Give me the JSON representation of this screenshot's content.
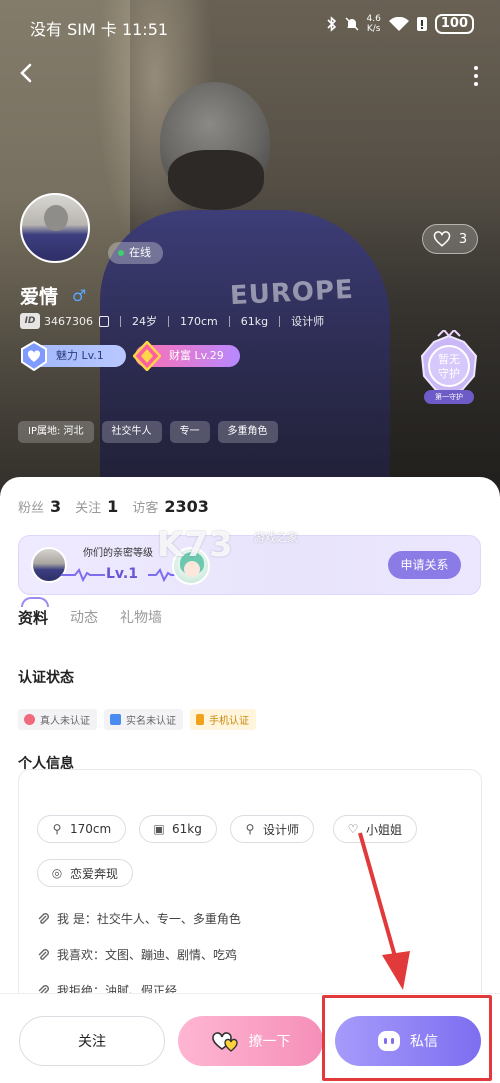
{
  "status_bar": {
    "carrier_time": "没有 SIM 卡 11:51",
    "net_speed_value": "4.6",
    "net_speed_unit": "K/s",
    "battery": "100"
  },
  "profile": {
    "online": "在线",
    "likes": "3",
    "username": "爱情",
    "id_label": "ID",
    "id": "3467306",
    "age": "24岁",
    "height": "170cm",
    "weight": "61kg",
    "job": "设计师",
    "charm_level": "魅力 Lv.1",
    "wealth_level": "财富 Lv.29",
    "guard_line1": "暂无",
    "guard_line2": "守护",
    "guard_rank": "第一守护",
    "tags": [
      "IP属地: 河北",
      "社交牛人",
      "专一",
      "多重角色"
    ]
  },
  "stats": {
    "fans_label": "粉丝",
    "fans": "3",
    "following_label": "关注",
    "following": "1",
    "visitors_label": "访客",
    "visitors": "2303"
  },
  "intimacy": {
    "label": "你们的亲密等级",
    "level": "Lv.1",
    "apply": "申请关系"
  },
  "watermark": {
    "main": "K73",
    "sub": "游戏之家"
  },
  "tabs": [
    "资料",
    "动态",
    "礼物墙"
  ],
  "certification": {
    "title": "认证状态",
    "items": [
      {
        "label": "真人未认证",
        "color": "#f06a7c"
      },
      {
        "label": "实名未认证",
        "color": "#4a8cf0"
      },
      {
        "label": "手机认证",
        "color": "#f0a21c"
      }
    ]
  },
  "personal": {
    "title": "个人信息",
    "chips": [
      "170cm",
      "61kg",
      "设计师",
      "小姐姐",
      "恋爱奔现"
    ],
    "lines": [
      "我  是：社交牛人、专一、多重角色",
      "我喜欢：文图、蹦迪、剧情、吃鸡",
      "我拒绝：油腻、假正经"
    ]
  },
  "actions": {
    "follow": "关注",
    "flirt": "撩一下",
    "message": "私信"
  },
  "colors": {
    "accent": "#7d6ef0",
    "highlight": "#e23a3a",
    "online": "#3dd06b"
  }
}
